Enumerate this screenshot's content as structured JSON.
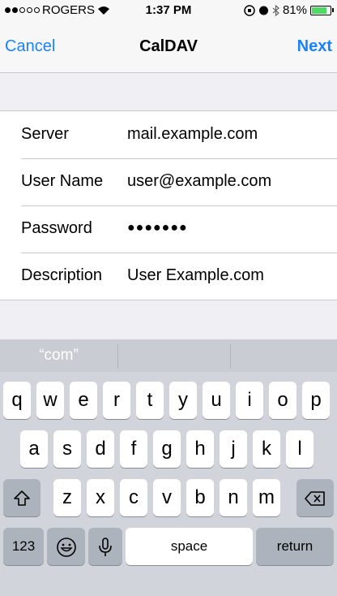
{
  "status_bar": {
    "carrier": "ROGERS",
    "time": "1:37 PM",
    "battery": "81%",
    "battery_level": 0.81,
    "signal_bars_filled": 2,
    "signal_bars_total": 5
  },
  "nav": {
    "cancel": "Cancel",
    "title": "CalDAV",
    "next": "Next"
  },
  "form": {
    "rows": [
      {
        "label": "Server",
        "value": "mail.example.com"
      },
      {
        "label": "User Name",
        "value": "user@example.com"
      },
      {
        "label": "Password",
        "value": "●●●●●●●"
      },
      {
        "label": "Description",
        "value": "User Example.com"
      }
    ]
  },
  "keyboard": {
    "suggestions": [
      "“com”",
      "",
      ""
    ],
    "row1": [
      "q",
      "w",
      "e",
      "r",
      "t",
      "y",
      "u",
      "i",
      "o",
      "p"
    ],
    "row2": [
      "a",
      "s",
      "d",
      "f",
      "g",
      "h",
      "j",
      "k",
      "l"
    ],
    "row3": [
      "z",
      "x",
      "c",
      "v",
      "b",
      "n",
      "m"
    ],
    "numbers_key": "123",
    "space_key": "space",
    "return_key": "return"
  },
  "colors": {
    "accent": "#1a82fb",
    "battery_fill": "#4cd964"
  }
}
